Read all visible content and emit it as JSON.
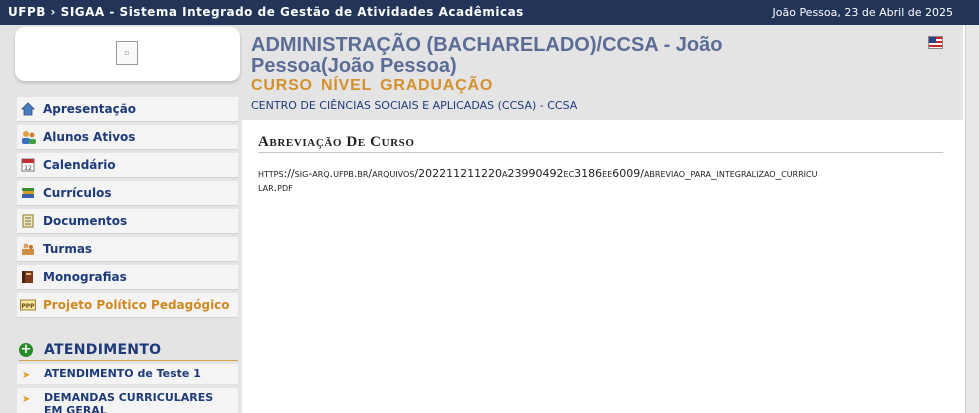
{
  "topbar": {
    "title": "UFPB › SIGAA - Sistema Integrado de Gestão de Atividades Acadêmicas",
    "date": "João Pessoa, 23 de Abril de 2025"
  },
  "menu": {
    "items": [
      {
        "label": "Apresentação",
        "icon": "home-icon"
      },
      {
        "label": "Alunos Ativos",
        "icon": "users-icon"
      },
      {
        "label": "Calendário",
        "icon": "calendar-icon"
      },
      {
        "label": "Currículos",
        "icon": "books-icon"
      },
      {
        "label": "Documentos",
        "icon": "document-icon"
      },
      {
        "label": "Turmas",
        "icon": "class-icon"
      },
      {
        "label": "Monografias",
        "icon": "book-icon"
      },
      {
        "label": "Projeto Político Pedagógico",
        "icon": "ppp-icon",
        "badge": "PPP"
      }
    ]
  },
  "atendimento": {
    "title": "ATENDIMENTO",
    "items": [
      {
        "label": "ATENDIMENTO de Teste 1"
      },
      {
        "label": "DEMANDAS CURRICULARES EM GERAL"
      }
    ]
  },
  "header": {
    "course_title": "ADMINISTRAÇÃO (BACHARELADO)/CCSA - João Pessoa(João Pessoa)",
    "course_level": "CURSO NÍVEL GRADUAÇÃO",
    "center": "CENTRO DE CIÊNCIAS SOCIAIS E APLICADAS (CCSA) - CCSA"
  },
  "content": {
    "section_title": "Abreviação De Curso",
    "link": "https://sig-arq.ufpb.br/arquivos/202211211220a23990492ec3186ee6009/abreviao_para_integralizao_curricular.pdf"
  },
  "colors": {
    "topbar": "#223559",
    "menu_text": "#1e3a78",
    "accent_orange": "#d4912a",
    "title_blue": "#5b6d96"
  }
}
